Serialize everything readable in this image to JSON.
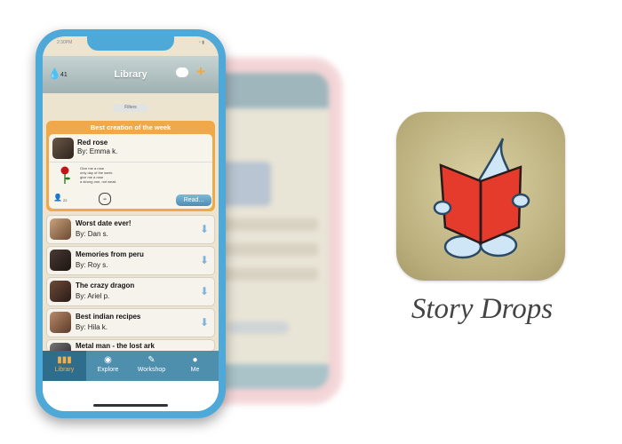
{
  "status_bar": {
    "time": "2:30PM",
    "icons": "◔ ▮"
  },
  "app_bar": {
    "drops_count": "41",
    "title": "Library"
  },
  "filters_label": "Filters",
  "best_of_week": {
    "header": "Best creation of the week",
    "title": "Red rose",
    "author": "By: Emma k.",
    "poem_lines": [
      "Give me a rose",
      "only day of the week",
      "give me a rose",
      "a strong one, not weak"
    ],
    "likes": "22",
    "read_label": "Read..."
  },
  "stories": [
    {
      "title": "Worst date ever!",
      "author": "By: Dan s."
    },
    {
      "title": "Memories from peru",
      "author": "By: Roy s."
    },
    {
      "title": "The crazy dragon",
      "author": "By: Ariel p."
    },
    {
      "title": "Best indian recipes",
      "author": "By: Hila k."
    },
    {
      "title": "Metal man - the lost ark",
      "author": ""
    }
  ],
  "nav": [
    {
      "label": "Library",
      "icon": "library-icon",
      "active": true
    },
    {
      "label": "Explore",
      "icon": "eye-icon",
      "active": false
    },
    {
      "label": "Workshop",
      "icon": "pen-icon",
      "active": false
    },
    {
      "label": "Me",
      "icon": "person-icon",
      "active": false
    }
  ],
  "app_name": "Story Drops",
  "colors": {
    "phone_frame": "#4fa9d8",
    "accent_orange": "#f0a94a",
    "nav_bar": "#4f8fae",
    "book_red": "#e43b2c"
  }
}
